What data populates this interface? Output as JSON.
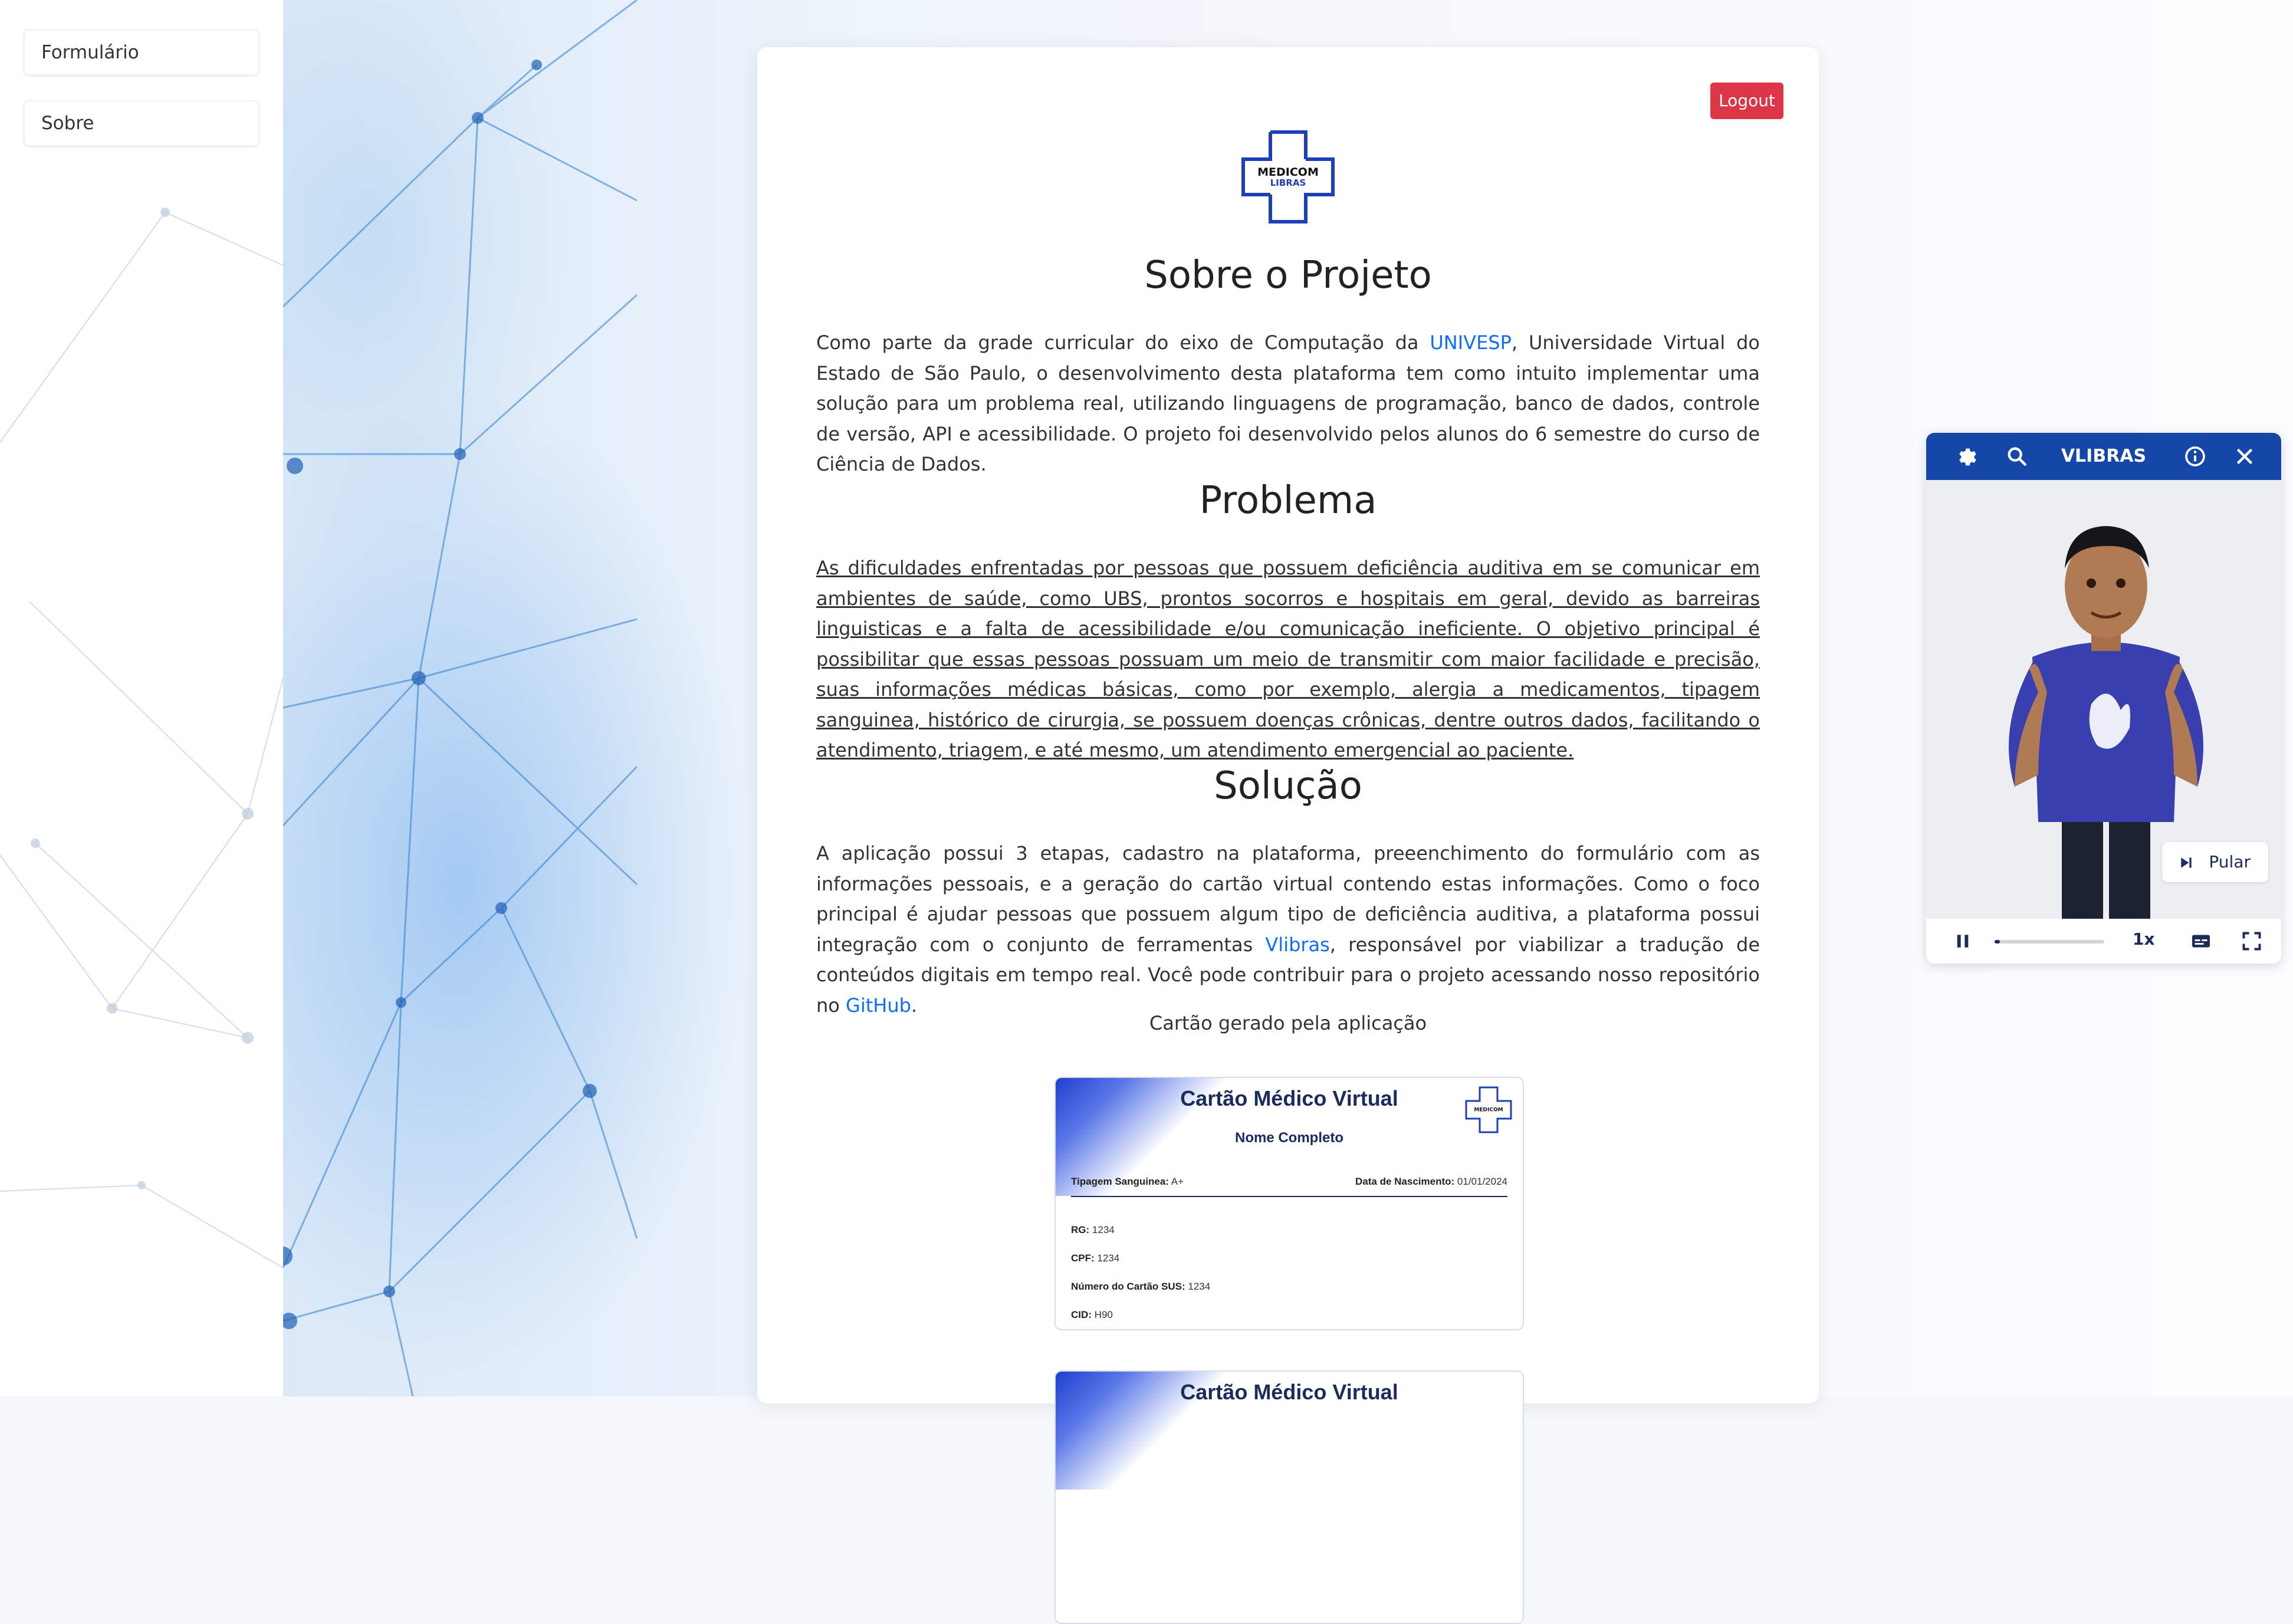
{
  "sidebar": {
    "items": [
      {
        "label": "Formulário"
      },
      {
        "label": "Sobre"
      }
    ]
  },
  "header": {
    "logout_label": "Logout",
    "logo_text_1": "MEDICOM",
    "logo_text_2": "LIBRAS"
  },
  "about": {
    "title": "Sobre o Projeto",
    "p1_before": "Como parte da grade curricular do eixo de Computação da ",
    "p1_link": "UNIVESP",
    "p1_after": ", Universidade Virtual do Estado de São Paulo, o desenvolvimento desta plataforma tem como intuito implementar uma solução para um problema real, utilizando linguagens de programação, banco de dados, controle de versão, API e acessibilidade. O projeto foi desenvolvido pelos alunos do 6 semestre do curso de Ciência de Dados."
  },
  "problem": {
    "title": "Problema",
    "text": "As dificuldades enfrentadas por pessoas que possuem deficiência auditiva em se comunicar em ambientes de saúde, como UBS, prontos socorros e hospitais em geral, devido as barreiras linguisticas e a falta de acessibilidade e/ou comunicação ineficiente. O objetivo principal é possibilitar que essas pessoas possuam um meio de transmitir com maior facilidade e precisão, suas informações médicas básicas, como por exemplo, alergia a medicamentos, tipagem sanguinea, histórico de cirurgia, se possuem doenças crônicas, dentre outros dados, facilitando o atendimento, triagem, e até mesmo, um atendimento emergencial ao paciente."
  },
  "solution": {
    "title": "Solução",
    "p_before": "A aplicação possui 3 etapas, cadastro na plataforma, preeenchimento do formulário com as informações pessoais, e a geração do cartão virtual contendo estas informações. Como o foco principal é ajudar pessoas que possuem algum tipo de deficiência auditiva, a plataforma possui integração com o conjunto de ferramentas ",
    "link_vlibras": "Vlibras",
    "p_middle": ", responsável por viabilizar a tradução de conteúdos digitais em tempo real. Você pode contribuir para o projeto acessando nosso repositório no ",
    "link_github": "GitHub",
    "p_end": ".",
    "caption": "Cartão gerado pela aplicação"
  },
  "virtual_card": {
    "title": "Cartão Médico Virtual",
    "name": "Nome Completo",
    "blood_label": "Tipagem Sanguinea:",
    "blood_value": "A+",
    "birth_label": "Data de Nascimento:",
    "birth_value": "01/01/2024",
    "rg_label": "RG:",
    "rg_value": "1234",
    "cpf_label": "CPF:",
    "cpf_value": "1234",
    "sus_label": "Número do Cartão SUS:",
    "sus_value": "1234",
    "cid_label": "CID:",
    "cid_value": "H90",
    "second_title": "Cartão Médico Virtual"
  },
  "vlibras": {
    "title": "VLIBRAS",
    "skip_label": "Pular",
    "speed_label": "1x",
    "progress": 0.05
  },
  "colors": {
    "accent": "#0d6efd",
    "logout": "#dc3545",
    "vlibras_header": "#1447a8",
    "brand_dark": "#1a2b5c"
  }
}
